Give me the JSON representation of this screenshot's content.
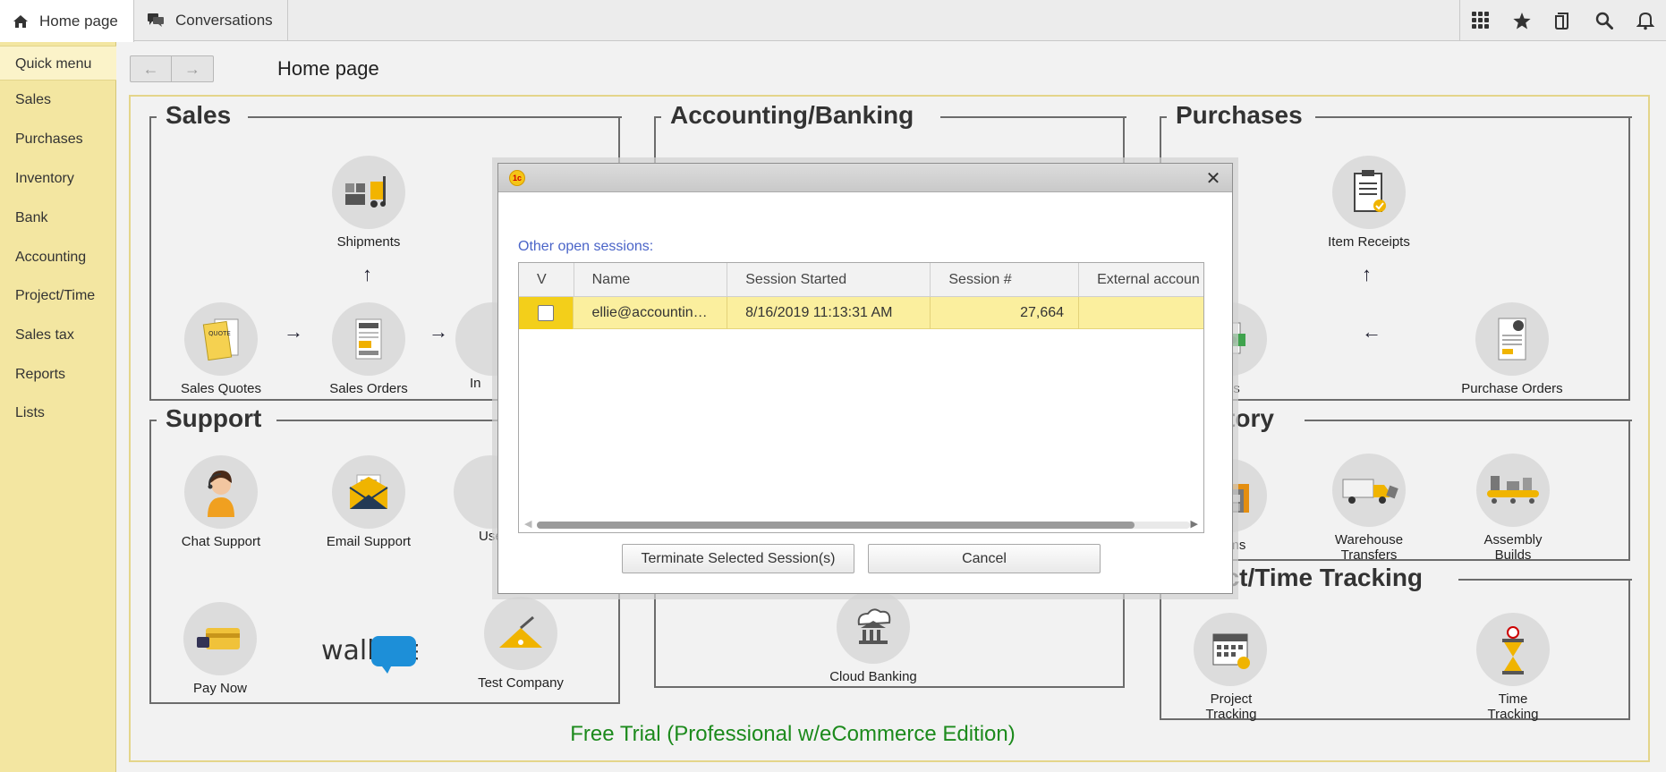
{
  "tabs": [
    {
      "label": "Home page",
      "icon": "home-icon"
    },
    {
      "label": "Conversations",
      "icon": "chat-icon"
    }
  ],
  "toolbar_icons": [
    "apps-grid-icon",
    "star-icon",
    "history-icon",
    "search-icon",
    "bell-icon"
  ],
  "sidebar": {
    "quick": "Quick menu",
    "items": [
      "Sales",
      "Purchases",
      "Inventory",
      "Bank",
      "Accounting",
      "Project/Time",
      "Sales tax",
      "Reports",
      "Lists"
    ]
  },
  "page_title": "Home page",
  "groups": {
    "sales": {
      "title": "Sales",
      "shipments": "Shipments",
      "quotes": "Sales Quotes",
      "orders": "Sales Orders",
      "invoices": "In"
    },
    "accounting": {
      "title": "Accounting/Banking",
      "cloud": "Cloud Banking"
    },
    "purchases": {
      "title": "Purchases",
      "receipts": "Item Receipts",
      "bills": "Bills",
      "po": "Purchase Orders"
    },
    "support": {
      "title": "Support",
      "chat": "Chat Support",
      "email": "Email Support",
      "user": "Use",
      "pay": "Pay Now",
      "walkme": "walkme",
      "test": "Test Company"
    },
    "inventory": {
      "title": "ntory",
      "items": "Items",
      "warehouse": "Warehouse Transfers",
      "assembly": "Assembly Builds"
    },
    "project": {
      "title": "ect/Time Tracking",
      "ptrack": "Project Tracking",
      "ttrack": "Time Tracking"
    }
  },
  "free_trial": "Free Trial (Professional w/eCommerce Edition)",
  "dialog": {
    "logo": "1c",
    "caption": "Other open sessions:",
    "columns": [
      "V",
      "Name",
      "Session Started",
      "Session #",
      "External accoun"
    ],
    "rows": [
      {
        "name": "ellie@accountin…",
        "started": "8/16/2019 11:13:31 AM",
        "session": "27,664",
        "external": ""
      }
    ],
    "terminate": "Terminate Selected Session(s)",
    "cancel": "Cancel"
  }
}
